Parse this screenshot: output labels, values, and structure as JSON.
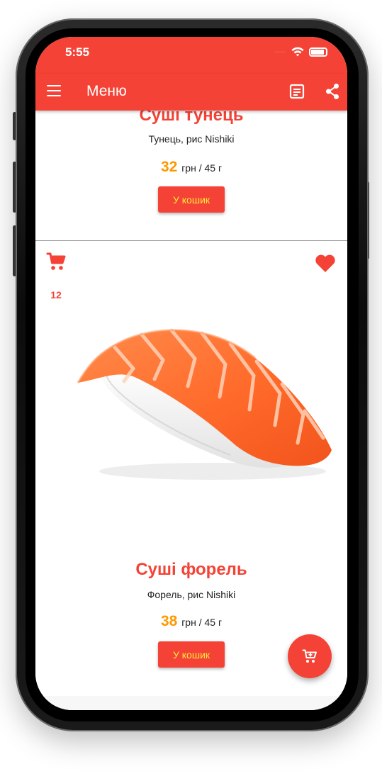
{
  "status_bar": {
    "time": "5:55",
    "signal_dots": "....",
    "wifi_icon": "wifi-icon",
    "battery_icon": "battery-icon"
  },
  "app_bar": {
    "title": "Меню",
    "menu_icon": "hamburger-menu-icon",
    "receipt_icon": "receipt-icon",
    "share_icon": "share-icon"
  },
  "colors": {
    "primary": "#f44336",
    "price": "#ff9800",
    "button_text": "#ffeb3b"
  },
  "menu_items": [
    {
      "title": "Суші тунець",
      "description": "Тунець, рис Nishiki",
      "price": "32",
      "price_unit": "грн / 45 г",
      "button_label": "У кошик"
    },
    {
      "title": "Суші форель",
      "description": "Форель, рис Nishiki",
      "price": "38",
      "price_unit": "грн / 45 г",
      "button_label": "У кошик",
      "cart_count": "12",
      "cart_icon": "cart-icon",
      "favorite_icon": "heart-icon",
      "image": "salmon-nigiri-image"
    }
  ],
  "fab": {
    "icon": "cart-icon"
  }
}
